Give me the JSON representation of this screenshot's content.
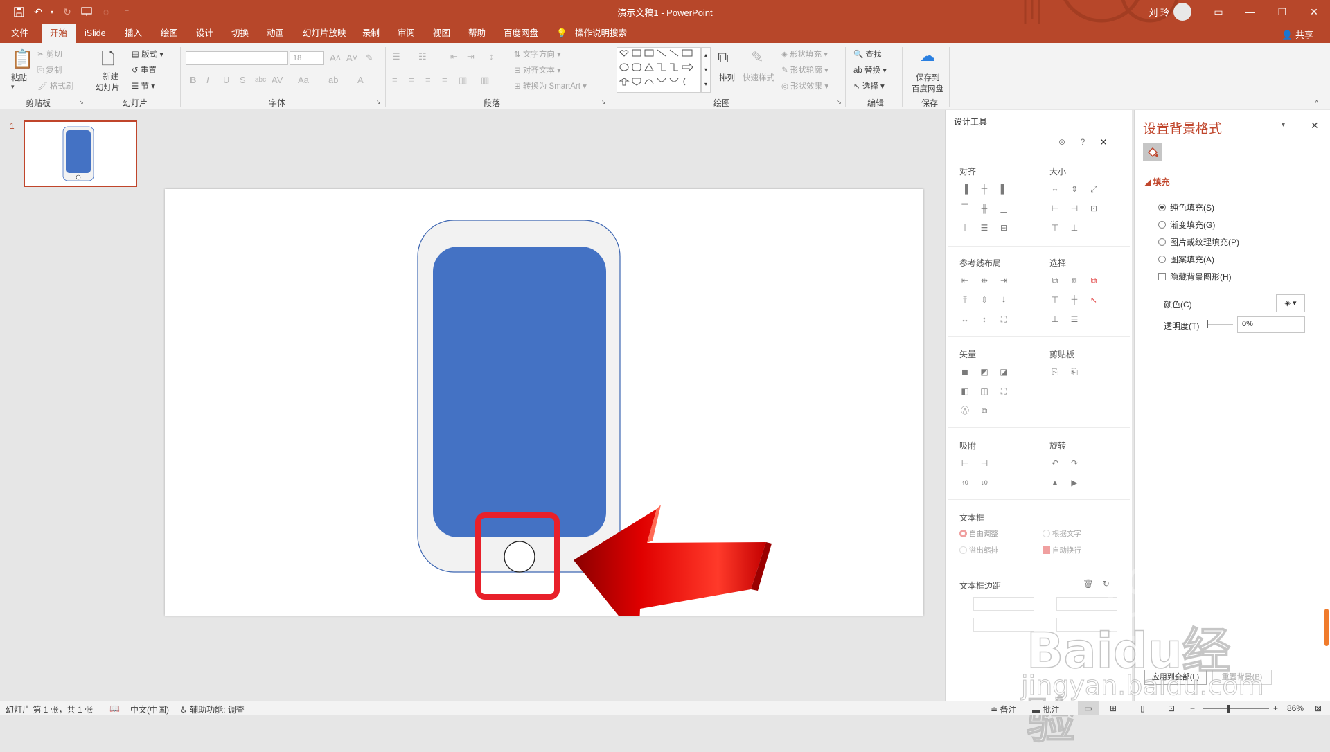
{
  "app": {
    "doc_title": "演示文稿1",
    "app_name": "PowerPoint",
    "separator": "-",
    "user_name": "刘 玲",
    "share_label": "共享"
  },
  "quick_access": {
    "more_label": "="
  },
  "menu": {
    "tabs": [
      "文件",
      "开始",
      "iSlide",
      "插入",
      "绘图",
      "设计",
      "切换",
      "动画",
      "幻灯片放映",
      "录制",
      "审阅",
      "视图",
      "帮助",
      "百度网盘"
    ],
    "active_index": 1,
    "tell_me": "操作说明搜索"
  },
  "ribbon": {
    "clipboard": {
      "paste": "粘贴",
      "cut": "剪切",
      "copy": "复制",
      "format_painter": "格式刷",
      "label": "剪贴板"
    },
    "slides": {
      "new_slide_1": "新建",
      "new_slide_2": "幻灯片",
      "layout": "版式",
      "reset": "重置",
      "section": "节",
      "label": "幻灯片"
    },
    "font": {
      "size": "18",
      "label": "字体"
    },
    "paragraph": {
      "text_direction": "文字方向",
      "align_text": "对齐文本",
      "smartart": "转换为 SmartArt",
      "label": "段落"
    },
    "drawing": {
      "arrange": "排列",
      "quick_styles": "快速样式",
      "shape_fill": "形状填充",
      "shape_outline": "形状轮廓",
      "shape_effects": "形状效果",
      "label": "绘图"
    },
    "editing": {
      "find": "查找",
      "replace": "替换",
      "select": "选择",
      "label": "编辑"
    },
    "save": {
      "line1": "保存到",
      "line2": "百度网盘",
      "label": "保存"
    }
  },
  "thumbnails": {
    "slide_number": "1"
  },
  "design_tools": {
    "title": "设计工具",
    "sections": {
      "align": "对齐",
      "size": "大小",
      "guides": "参考线布局",
      "select": "选择",
      "vector": "矢量",
      "clipboard": "剪贴板",
      "snap": "吸附",
      "rotate": "旋转",
      "textbox": "文本框",
      "margin": "文本框边距"
    },
    "textbox_opts": {
      "auto_fit": "自由调整",
      "by_text": "根据文字",
      "overflow": "溢出缩排",
      "auto_wrap": "自动换行"
    }
  },
  "format_background": {
    "title": "设置背景格式",
    "fill_label": "填充",
    "options": [
      "纯色填充(S)",
      "渐变填充(G)",
      "图片或纹理填充(P)",
      "图案填充(A)"
    ],
    "selected_option": 0,
    "hide_bg": "隐藏背景图形(H)",
    "color_label": "颜色(C)",
    "transparency_label": "透明度(T)",
    "transparency_value": "0%",
    "apply_all": "应用到全部(L)",
    "reset_bg": "重置背景(B)"
  },
  "statusbar": {
    "slide_info": "幻灯片 第 1 张，共 1 张",
    "language": "中文(中国)",
    "accessibility": "辅助功能: 调查",
    "notes": "备注",
    "comments": "批注",
    "zoom": "86%"
  },
  "watermark": {
    "brand": "Baidu经验",
    "url": "jingyan.baidu.com"
  },
  "colors": {
    "title_bar": "#b7472a",
    "screen_fill": "#4472c4",
    "phone_body": "#f2f2f2",
    "highlight_box": "#e8202a",
    "arrow": "#e00000"
  }
}
